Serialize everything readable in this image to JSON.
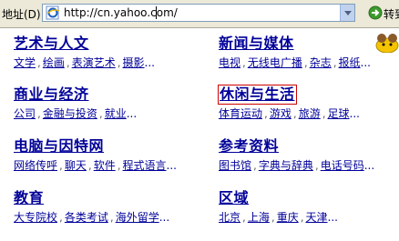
{
  "address_bar": {
    "label": "地址(D)",
    "url": "http://cn.yahoo.com/",
    "go_label": "转到"
  },
  "categories": [
    {
      "title": "艺术与人文",
      "links": [
        "文学",
        "绘画",
        "表演艺术",
        "摄影"
      ],
      "more": "..."
    },
    {
      "title": "新闻与媒体",
      "links": [
        "电视",
        "无线电广播",
        "杂志",
        "报纸"
      ],
      "more": "..."
    },
    {
      "title": "商业与经济",
      "links": [
        "公司",
        "金融与投资",
        "就业"
      ],
      "more": "..."
    },
    {
      "title": "休闲与生活",
      "links": [
        "体育运动",
        "游戏",
        "旅游",
        "足球"
      ],
      "more": "..."
    },
    {
      "title": "电脑与因特网",
      "links": [
        "网络传呼",
        "聊天",
        "软件",
        "程式语言"
      ],
      "more": "..."
    },
    {
      "title": "参考资料",
      "links": [
        "图书馆",
        "字典与辞典",
        "电话号码"
      ],
      "more": "..."
    },
    {
      "title": "教育",
      "links": [
        "大专院校",
        "各类考试",
        "海外留学"
      ],
      "more": "..."
    },
    {
      "title": "区域",
      "links": [
        "北京",
        "上海",
        "重庆",
        "天津"
      ],
      "more": "..."
    }
  ],
  "colors": {
    "link": "#000099",
    "highlight_box": "#cc0000",
    "toolbar_bg": "#ece9d8"
  }
}
